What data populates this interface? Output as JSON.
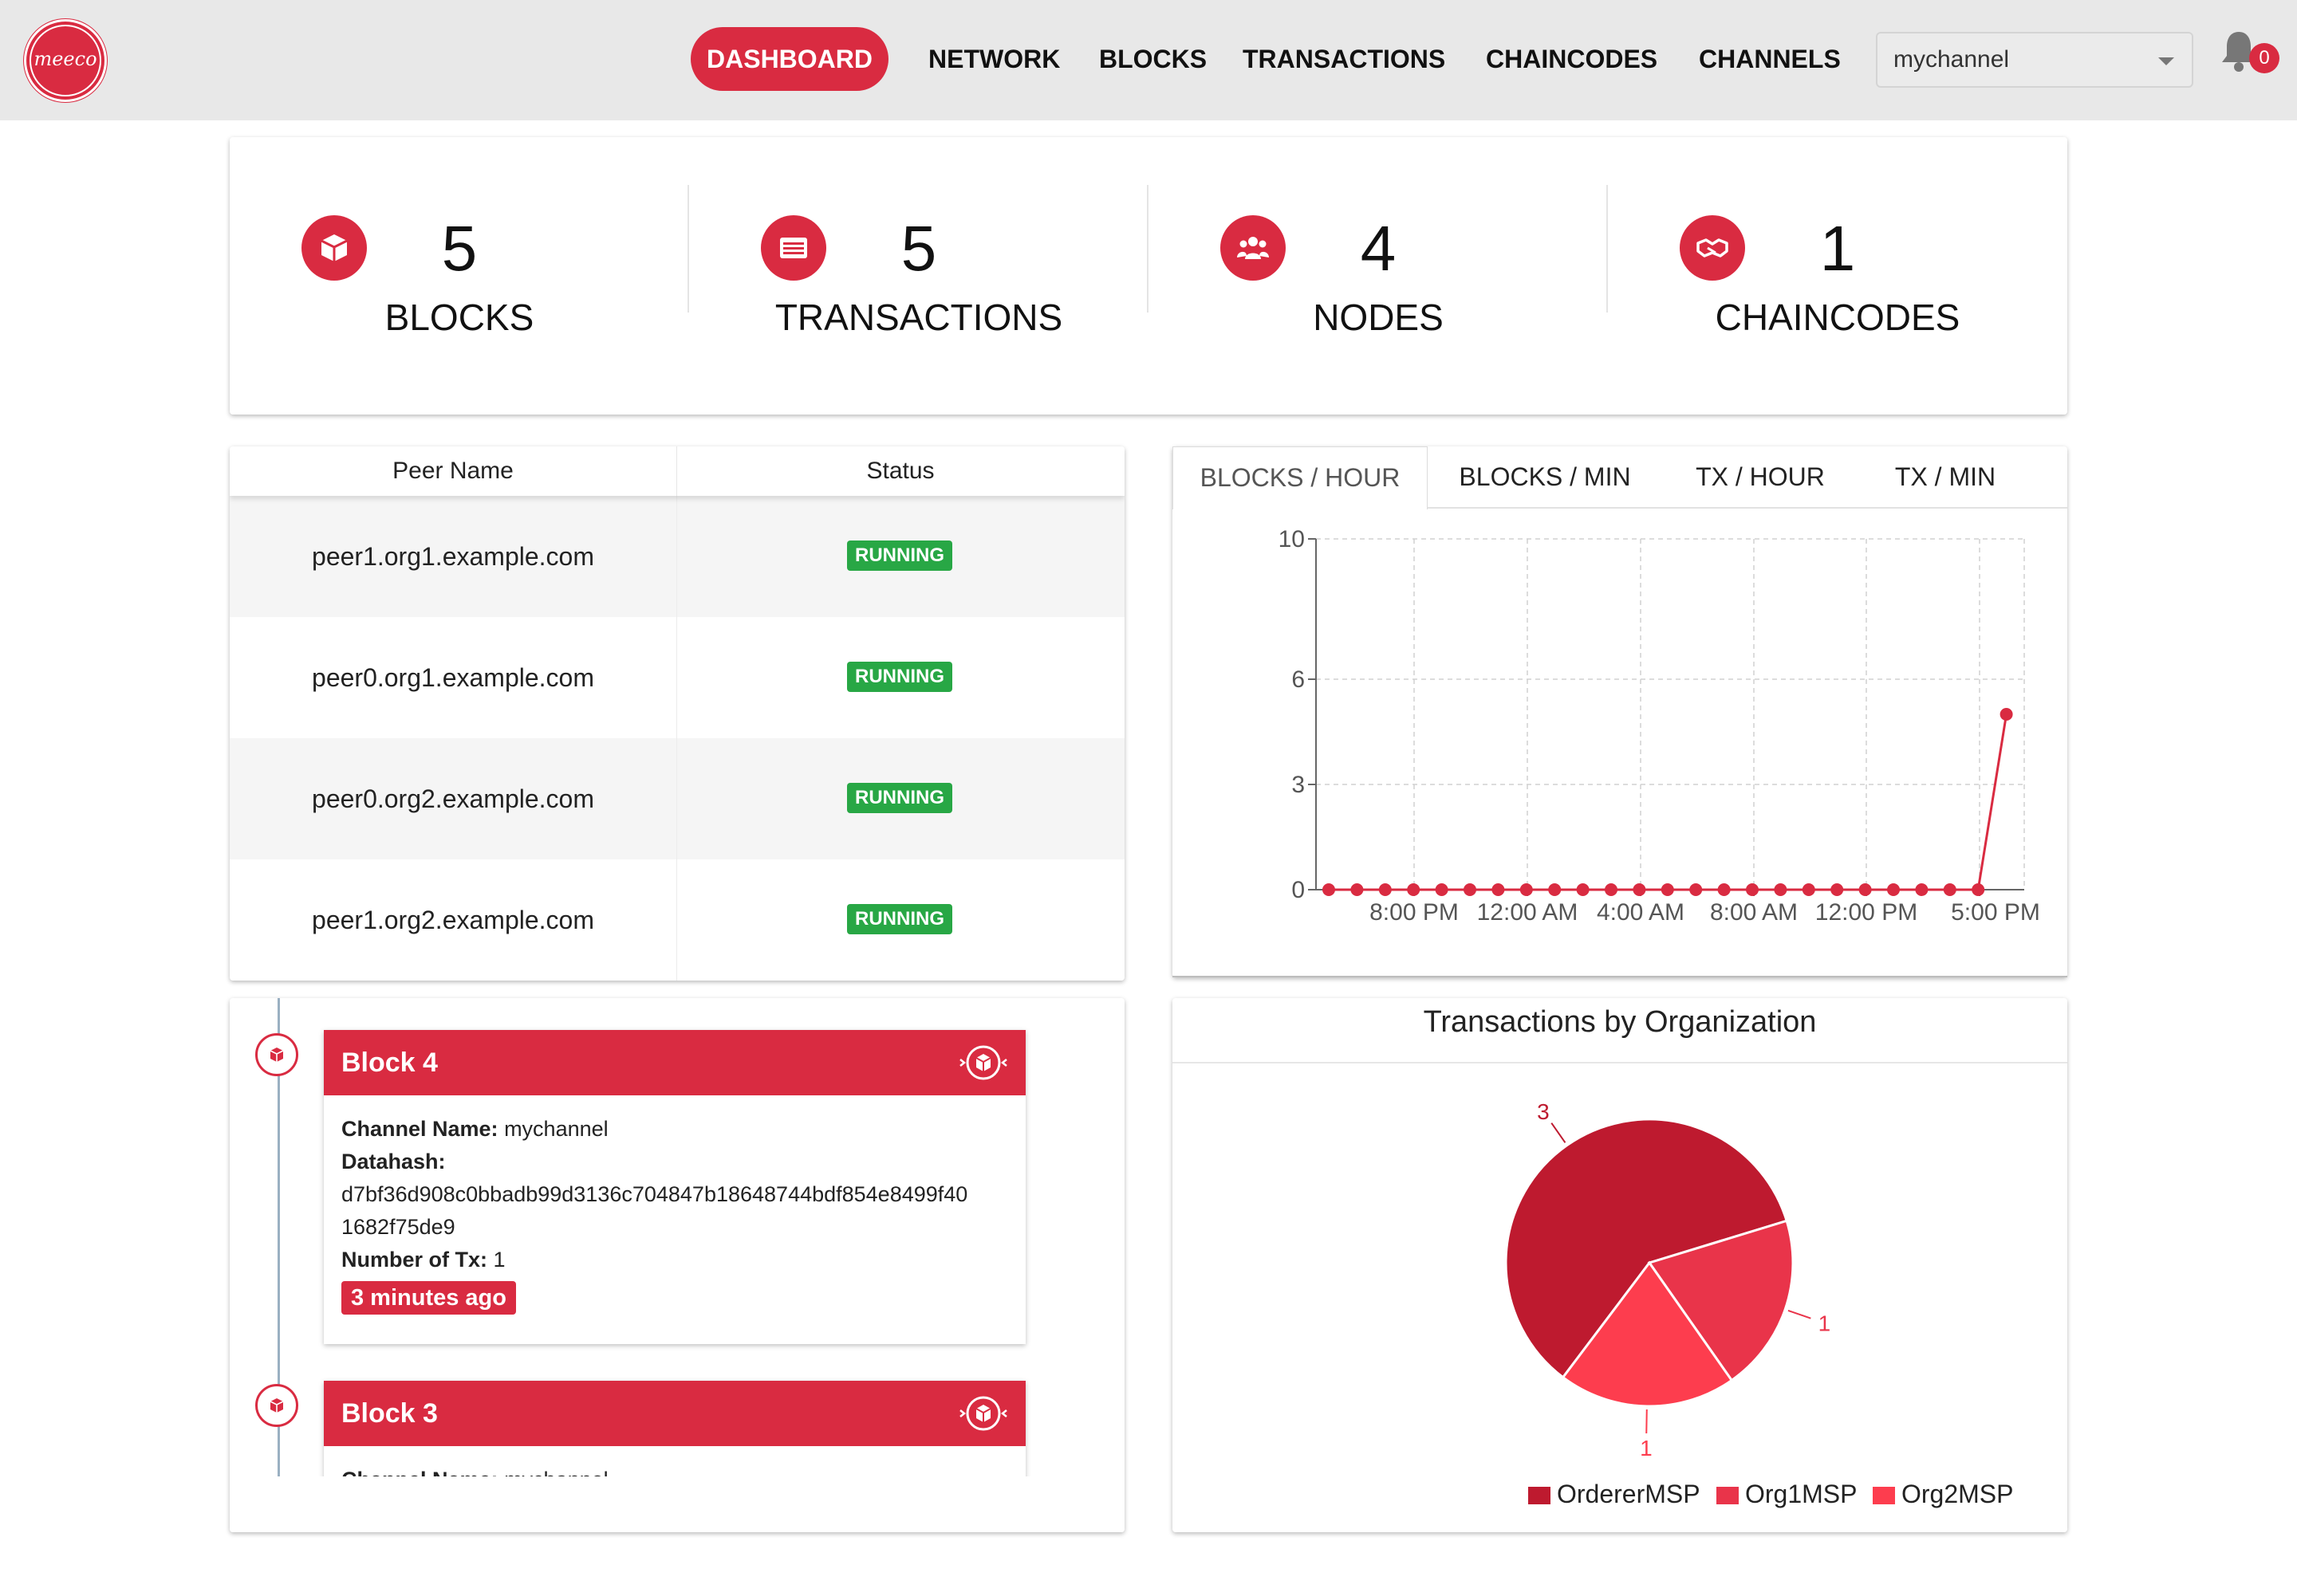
{
  "brand": {
    "logo_text": "meeco"
  },
  "nav": {
    "items": [
      {
        "label": "DASHBOARD",
        "active": true
      },
      {
        "label": "NETWORK"
      },
      {
        "label": "BLOCKS"
      },
      {
        "label": "TRANSACTIONS"
      },
      {
        "label": "CHAINCODES"
      },
      {
        "label": "CHANNELS"
      }
    ],
    "channel_select": "mychannel",
    "notifications_count": "0"
  },
  "stats": [
    {
      "value": "5",
      "label": "BLOCKS",
      "icon": "cube-icon"
    },
    {
      "value": "5",
      "label": "TRANSACTIONS",
      "icon": "list-icon"
    },
    {
      "value": "4",
      "label": "NODES",
      "icon": "users-icon"
    },
    {
      "value": "1",
      "label": "CHAINCODES",
      "icon": "handshake-icon"
    }
  ],
  "peers": {
    "headers": [
      "Peer Name",
      "Status"
    ],
    "rows": [
      {
        "name": "peer1.org1.example.com",
        "status": "RUNNING"
      },
      {
        "name": "peer0.org1.example.com",
        "status": "RUNNING"
      },
      {
        "name": "peer0.org2.example.com",
        "status": "RUNNING"
      },
      {
        "name": "peer1.org2.example.com",
        "status": "RUNNING"
      }
    ]
  },
  "chart_tabs": [
    "BLOCKS / HOUR",
    "BLOCKS / MIN",
    "TX / HOUR",
    "TX / MIN"
  ],
  "chart_data": [
    {
      "type": "line",
      "title": "",
      "xlabel": "",
      "ylabel": "",
      "y_ticks": [
        0,
        3,
        6,
        10
      ],
      "ylim": [
        0,
        10
      ],
      "x_tick_labels": [
        "8:00 PM",
        "12:00 AM",
        "4:00 AM",
        "8:00 AM",
        "12:00 PM",
        "5:00 PM"
      ],
      "grid": true,
      "color": "#d92b41",
      "series": [
        {
          "values": [
            0,
            0,
            0,
            0,
            0,
            0,
            0,
            0,
            0,
            0,
            0,
            0,
            0,
            0,
            0,
            0,
            0,
            0,
            0,
            0,
            0,
            0,
            0,
            0,
            5
          ]
        }
      ]
    },
    {
      "type": "pie",
      "title": "Transactions by Organization",
      "labels": [
        "OrdererMSP",
        "Org1MSP",
        "Org2MSP"
      ],
      "values": [
        3,
        1,
        1
      ],
      "colors": [
        "#be1a2f",
        "#e9344a",
        "#fd3d4e"
      ],
      "legend": "bottom"
    }
  ],
  "blocks": [
    {
      "title": "Block 4",
      "channel_label": "Channel Name:",
      "channel": "mychannel",
      "datahash_label": "Datahash:",
      "datahash_1": "d7bf36d908c0bbadb99d3136c704847b18648744bdf854e8499f40",
      "datahash_2": "1682f75de9",
      "ntx_label": "Number of Tx:",
      "ntx": "1",
      "time": "3 minutes ago"
    },
    {
      "title": "Block 3",
      "channel_label": "Channel Name:",
      "channel": "mychannel"
    }
  ]
}
